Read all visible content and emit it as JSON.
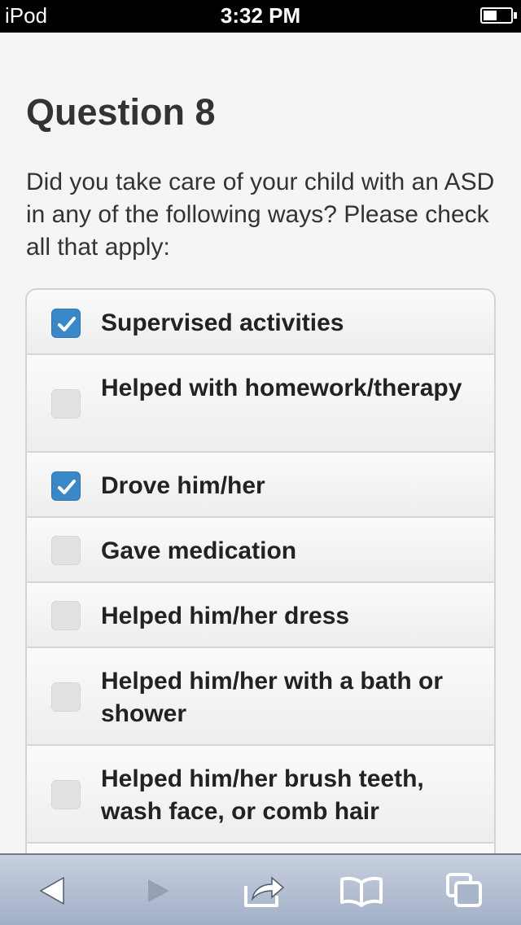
{
  "status_bar": {
    "device": "iPod",
    "time": "3:32 PM"
  },
  "page": {
    "title": "Question 8",
    "prompt": "Did you take care of your child with an ASD in any of the following ways? Please check all that apply:"
  },
  "options": [
    {
      "label": "Supervised activities",
      "checked": true
    },
    {
      "label": "Helped with homework/therapy",
      "checked": false
    },
    {
      "label": "Drove him/her",
      "checked": true
    },
    {
      "label": "Gave medication",
      "checked": false
    },
    {
      "label": "Helped him/her dress",
      "checked": false
    },
    {
      "label": "Helped him/her with a bath or shower",
      "checked": false
    },
    {
      "label": "Helped him/her brush teeth, wash face, or comb hair",
      "checked": false
    },
    {
      "label": "",
      "checked": false
    }
  ],
  "toolbar": {
    "icons": [
      "back-icon",
      "forward-icon",
      "share-icon",
      "bookmarks-icon",
      "tabs-icon"
    ]
  },
  "colors": {
    "check_blue": "#3a88c7",
    "toolbar_top": "#c8d0df",
    "toolbar_bottom": "#a2afc6"
  }
}
